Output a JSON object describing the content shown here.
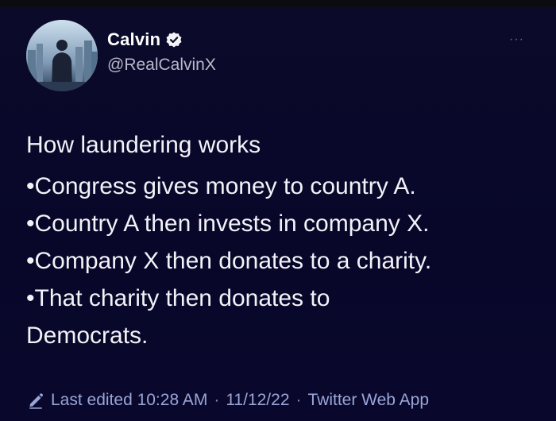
{
  "tweet": {
    "author": {
      "name": "Calvin",
      "handle": "@RealCalvinX",
      "verified": true
    },
    "more_icon": "···",
    "heading": "How laundering works",
    "lines": [
      "•Congress gives money to country A.",
      "•Country A then invests in company X.",
      "•Company X then donates to a charity.",
      "•That charity then donates to",
      "Democrats."
    ],
    "footer": {
      "edited_label": "Last edited 10:28 AM",
      "separator": "·",
      "date": "11/12/22",
      "separator2": "·",
      "source": "Twitter Web App"
    }
  },
  "colors": {
    "background": "#0a092b",
    "text": "#f2f2f7",
    "muted": "#b7b8c8",
    "accent": "#9aa6d8"
  },
  "icons": {
    "verified": "verified-badge-icon",
    "pencil": "pencil-icon",
    "more": "more-options-icon"
  }
}
